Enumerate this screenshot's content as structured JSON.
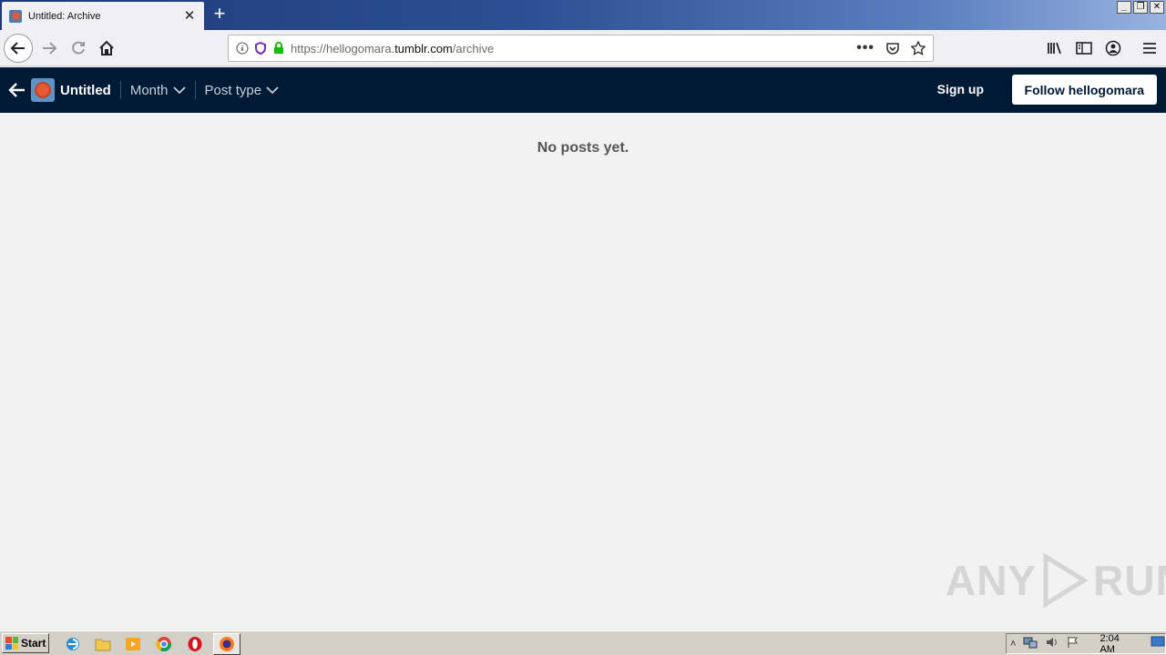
{
  "browser": {
    "tab": {
      "title": "Untitled: Archive",
      "close": "✕"
    },
    "new_tab": "+",
    "url": {
      "prefix": "https://hellogomara.",
      "domain": "tumblr.com",
      "path": "/archive"
    }
  },
  "tumblr": {
    "blog_name": "Untitled",
    "filters": [
      {
        "label": "Month"
      },
      {
        "label": "Post type"
      }
    ],
    "sign_up": "Sign up",
    "follow": "Follow hellogomara",
    "empty_message": "No posts yet."
  },
  "watermark": {
    "left": "ANY",
    "right": "RUN"
  },
  "taskbar": {
    "start": "Start",
    "clock": "2:04 AM"
  },
  "colors": {
    "tumblr_navy": "#001935",
    "page_bg": "#f2f2f2",
    "tab_strip": "#2c4f93",
    "taskbar": "#d4d0c8"
  }
}
